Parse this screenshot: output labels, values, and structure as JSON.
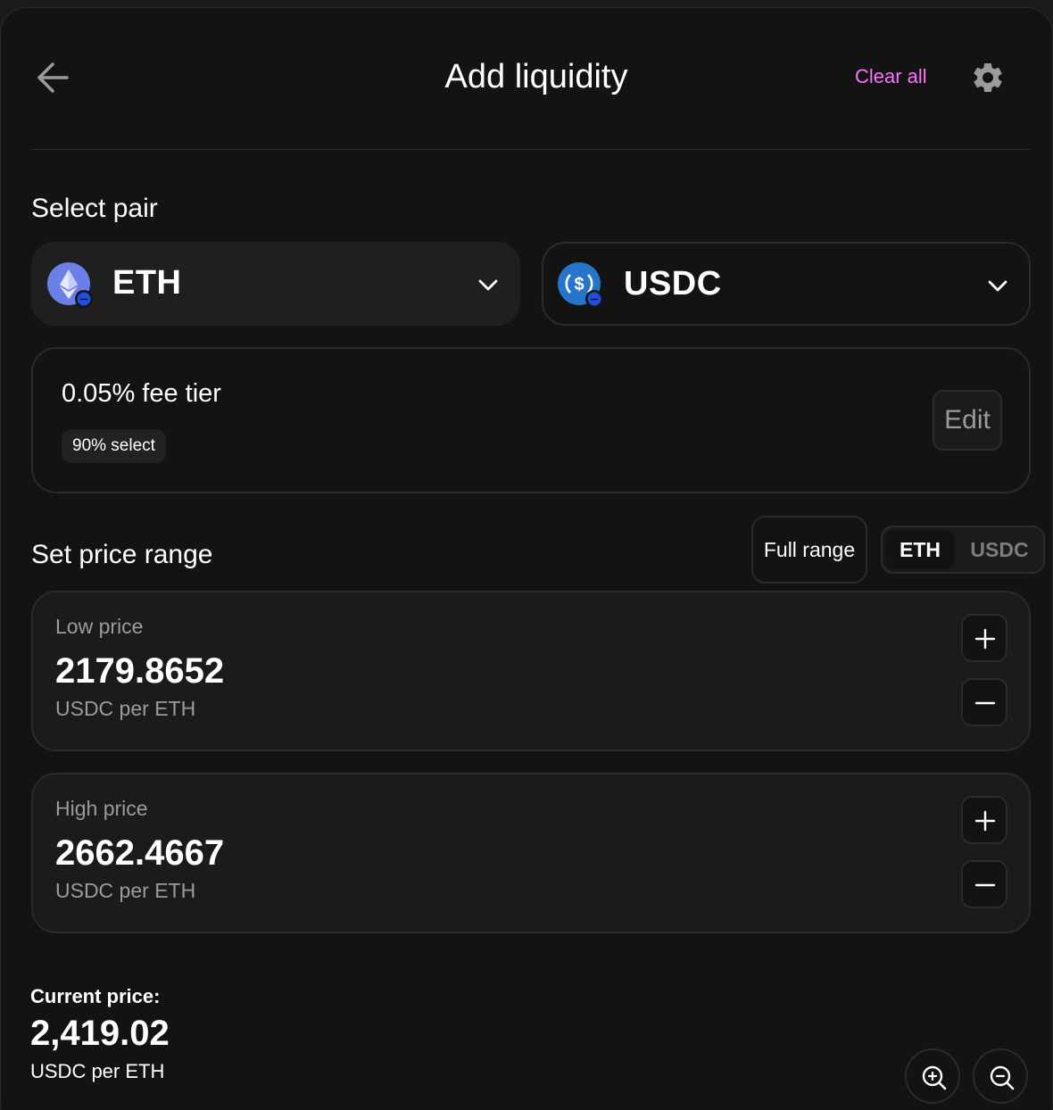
{
  "header": {
    "title": "Add liquidity",
    "clear_all_label": "Clear all",
    "back_icon": "arrow-left-icon",
    "settings_icon": "gear-icon"
  },
  "select_pair": {
    "heading": "Select pair",
    "token_a": {
      "symbol": "ETH",
      "icon": "eth-token-icon"
    },
    "token_b": {
      "symbol": "USDC",
      "icon": "usdc-token-icon"
    }
  },
  "fee": {
    "title": "0.05% fee tier",
    "badge": "90% select",
    "edit_label": "Edit"
  },
  "price_range": {
    "heading": "Set price range",
    "full_range_label": "Full range",
    "toggle": {
      "options": [
        "ETH",
        "USDC"
      ],
      "selected": "ETH"
    },
    "low": {
      "label": "Low price",
      "value": "2179.8652",
      "unit": "USDC per ETH"
    },
    "high": {
      "label": "High price",
      "value": "2662.4667",
      "unit": "USDC per ETH"
    }
  },
  "current_price": {
    "label": "Current price:",
    "value": "2,419.02",
    "unit": "USDC per ETH"
  },
  "colors": {
    "accent": "#fc72ff",
    "background": "#131313",
    "border": "#2b2b2b",
    "muted_text": "#9b9b9b"
  }
}
